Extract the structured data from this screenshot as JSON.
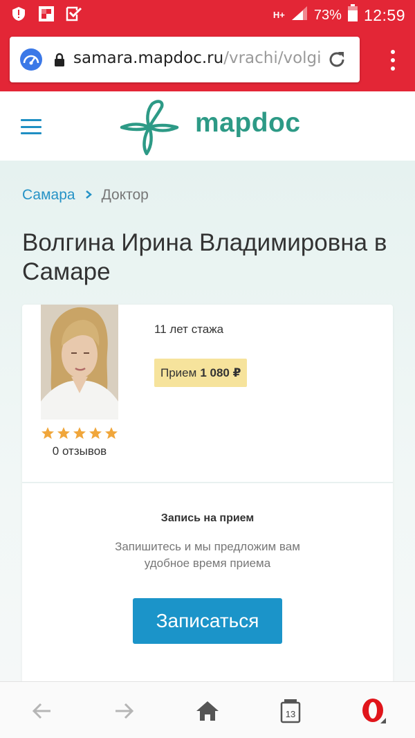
{
  "status_bar": {
    "network": "H+",
    "battery": "73%",
    "time": "12:59",
    "icons": [
      "shield-alert-icon",
      "flipboard-icon",
      "checkbox-icon",
      "signal-icon",
      "battery-icon"
    ]
  },
  "browser": {
    "url_host": "samara.mapdoc.ru",
    "url_path": "/vrachi/volgin",
    "icons": [
      "speed-dial-icon",
      "lock-icon",
      "reload-icon",
      "overflow-menu-icon"
    ]
  },
  "header": {
    "logo_text": "mapdoc",
    "brand_color": "#2d9a86",
    "icons": [
      "hamburger-menu-icon",
      "mapdoc-logo-icon"
    ]
  },
  "breadcrumb": {
    "city": "Самара",
    "current": "Доктор"
  },
  "page": {
    "title": "Волгина Ирина Владимировна в Самаре"
  },
  "doctor": {
    "rating": 5,
    "rating_max": 5,
    "reviews": "0 отзывов",
    "experience": "11 лет стажа",
    "price_label": "Прием",
    "price_value": "1 080 ₽",
    "photo": "doctor-photo"
  },
  "appointment": {
    "title": "Запись на прием",
    "text": "Запишитесь и мы предложим вам удобное время приема",
    "button": "Записаться",
    "button_color": "#1b94c9"
  },
  "bottom_nav": {
    "tabs_count": "13",
    "items": [
      "back-icon",
      "forward-icon",
      "home-icon",
      "tabs-icon",
      "opera-menu-icon"
    ]
  },
  "colors": {
    "browser_red": "#e32636",
    "link_blue": "#2592c6",
    "price_badge": "#f6e39c",
    "star": "#f0a63b"
  }
}
